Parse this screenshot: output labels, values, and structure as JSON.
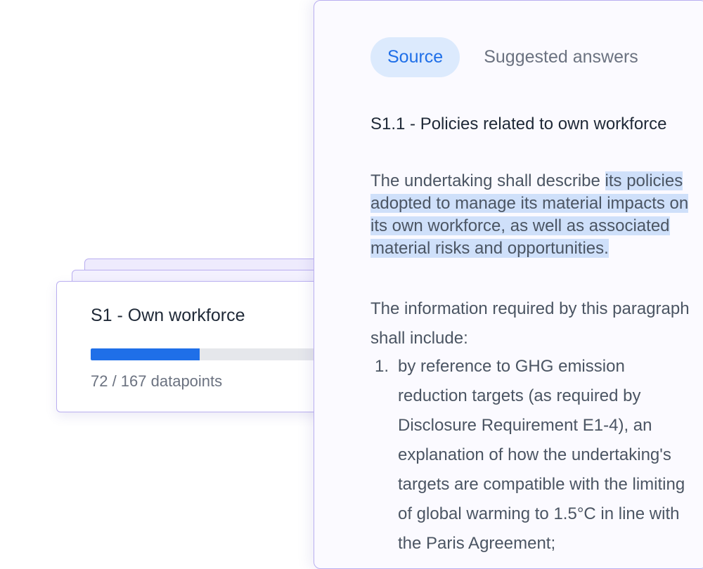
{
  "card": {
    "title": "S1 - Own workforce",
    "progress_done": 72,
    "progress_total": 167,
    "count_label": "72 / 167 datapoints"
  },
  "panel": {
    "tabs": [
      {
        "label": "Source",
        "active": true
      },
      {
        "label": "Suggested answers",
        "active": false
      }
    ],
    "heading": "S1.1 - Policies related to own workforce",
    "paragraph1": {
      "line1_plain": "The undertaking shall describe ",
      "line1_highlight": "its policies",
      "line2": "adopted to manage its material impacts on",
      "line3": "its own workforce, as well as associated",
      "line4": "material risks and opportunities."
    },
    "paragraph2": {
      "line1": "The information required by this paragraph",
      "line2": "shall include:"
    },
    "list_item_1": {
      "number": "1.",
      "lines": [
        "by reference to GHG emission",
        "reduction targets (as required by",
        "Disclosure Requirement E1-4), an",
        "explanation of how the undertaking's",
        "targets are compatible with the limiting",
        "of global warming to 1.5°C in line with",
        "the Paris Agreement;"
      ]
    }
  },
  "colors": {
    "accent": "#1f6fe8",
    "border": "#b9aef0",
    "highlight": "#cfe0fa",
    "tab_active_bg": "#dceafd"
  }
}
